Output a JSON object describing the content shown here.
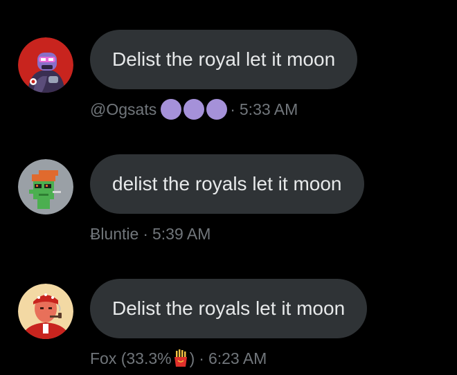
{
  "messages": [
    {
      "text": "Delist the royal let it moon",
      "author": "@Ogsats",
      "separator": "·",
      "time": "5:33 AM",
      "author_badge": {
        "type": "dots",
        "count": 3,
        "color": "#a591d9"
      },
      "avatar_icon": "robot-avatar-icon"
    },
    {
      "text": "delist the royals let it moon",
      "author": "Ƀluntie",
      "separator": "·",
      "time": "5:39 AM",
      "avatar_icon": "pixel-punk-avatar-icon"
    },
    {
      "text": "Delist the royals let it moon",
      "author": "Fox (33.3%",
      "author_suffix": ")",
      "separator": "·",
      "time": "6:23 AM",
      "author_emoji": "fries-emoji-icon",
      "avatar_icon": "bandana-smoker-avatar-icon"
    }
  ],
  "colors": {
    "background": "#000000",
    "bubble": "#2f3336",
    "text": "#e7e9ea",
    "meta": "#71767b"
  }
}
